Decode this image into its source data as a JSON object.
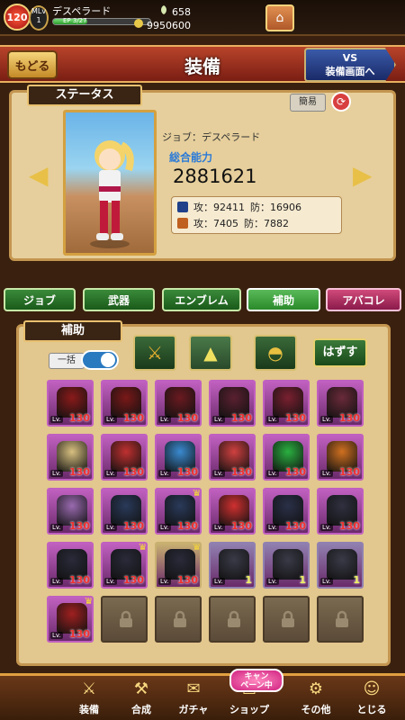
{
  "topbar": {
    "level": "120",
    "mlv_label": "MLv",
    "mlv_value": "1",
    "player_name": "デスペラード",
    "stamina": "EP 3/27",
    "resource1": "658",
    "resource2": "9950600",
    "exp_fraction": 0.35
  },
  "header": {
    "back_label": "もどる",
    "title": "装備",
    "vs_label_line1": "VS",
    "vs_label_line2": "装備画面へ"
  },
  "status": {
    "tag": "ステータス",
    "simple_label": "簡易",
    "job_label": "ジョブ：デスペラード",
    "power_label": "総合能力",
    "power_value": "2881621",
    "atk1": "攻：92411",
    "def1": "防：16906",
    "atk2": "攻：7405",
    "def2": "防：7882"
  },
  "tabs": [
    {
      "label": "ジョブ"
    },
    {
      "label": "武器"
    },
    {
      "label": "エンブレム"
    },
    {
      "label": "補助"
    },
    {
      "label": "アバコレ"
    }
  ],
  "equip": {
    "tag": "補助",
    "bulk_label": "一括",
    "unequip_label": "はずす"
  },
  "grid": [
    {
      "lv": "130",
      "crown": false,
      "color": "#8a1a1a",
      "frame": "#c060c0"
    },
    {
      "lv": "130",
      "crown": false,
      "color": "#7a1818",
      "frame": "#c060c0"
    },
    {
      "lv": "130",
      "crown": false,
      "color": "#6a1a20",
      "frame": "#c060c0"
    },
    {
      "lv": "130",
      "crown": false,
      "color": "#5a2030",
      "frame": "#c060c0"
    },
    {
      "lv": "130",
      "crown": false,
      "color": "#7a2030",
      "frame": "#c060c0"
    },
    {
      "lv": "130",
      "crown": false,
      "color": "#6a2a3a",
      "frame": "#c060c0"
    },
    {
      "lv": "130",
      "crown": false,
      "color": "#d8c080",
      "frame": "#c060c0"
    },
    {
      "lv": "130",
      "crown": false,
      "color": "#c03030",
      "frame": "#c060c0"
    },
    {
      "lv": "130",
      "crown": false,
      "color": "#3a8ad0",
      "frame": "#c060c0"
    },
    {
      "lv": "130",
      "crown": false,
      "color": "#d04040",
      "frame": "#c060c0"
    },
    {
      "lv": "130",
      "crown": false,
      "color": "#2ab040",
      "frame": "#c060c0"
    },
    {
      "lv": "130",
      "crown": false,
      "color": "#d07020",
      "frame": "#c060c0"
    },
    {
      "lv": "130",
      "crown": false,
      "color": "#9a6ab0",
      "frame": "#c060c0"
    },
    {
      "lv": "130",
      "crown": false,
      "color": "#2a3a5a",
      "frame": "#c060c0"
    },
    {
      "lv": "130",
      "crown": true,
      "color": "#2a3a5a",
      "frame": "#c060c0"
    },
    {
      "lv": "130",
      "crown": false,
      "color": "#d03030",
      "frame": "#c060c0"
    },
    {
      "lv": "130",
      "crown": false,
      "color": "#2a3048",
      "frame": "#c060c0"
    },
    {
      "lv": "130",
      "crown": false,
      "color": "#303040",
      "frame": "#c060c0"
    },
    {
      "lv": "130",
      "crown": false,
      "color": "#2a2a3a",
      "frame": "#c060c0"
    },
    {
      "lv": "130",
      "crown": true,
      "color": "#2a2a3a",
      "frame": "#c060c0"
    },
    {
      "lv": "130",
      "crown": true,
      "color": "#2a2a3a",
      "frame": "#c8b070"
    },
    {
      "lv": "1",
      "crown": false,
      "color": "#3a3a48",
      "frame": "#9080b0"
    },
    {
      "lv": "1",
      "crown": false,
      "color": "#3a3a48",
      "frame": "#9080b0"
    },
    {
      "lv": "1",
      "crown": false,
      "color": "#3a3a48",
      "frame": "#9080b0"
    },
    {
      "lv": "130",
      "crown": true,
      "color": "#a02020",
      "frame": "#c060c0"
    },
    {
      "locked": true
    },
    {
      "locked": true
    },
    {
      "locked": true
    },
    {
      "locked": true
    },
    {
      "locked": true
    }
  ],
  "campaign": {
    "line1": "キャン",
    "line2": "ペーン中"
  },
  "nav": [
    {
      "label": "装備",
      "icon": "equip-icon"
    },
    {
      "label": "合成",
      "icon": "hammer-icon"
    },
    {
      "label": "ガチャ",
      "icon": "gacha-icon"
    },
    {
      "label": "ショップ",
      "icon": "shop-icon"
    },
    {
      "label": "その他",
      "icon": "gear-icon"
    },
    {
      "label": "とじる",
      "icon": "close-icon"
    }
  ]
}
